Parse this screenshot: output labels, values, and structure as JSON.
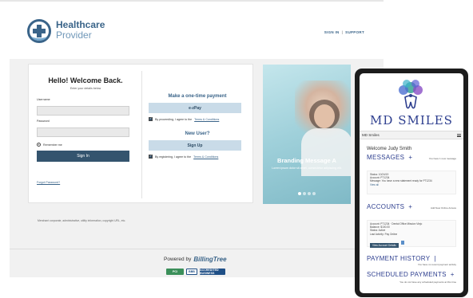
{
  "header": {
    "brand_line1": "Healthcare",
    "brand_line2": "Provider",
    "signin": "SIGN IN",
    "support": "SUPPORT"
  },
  "login": {
    "title": "Hello! Welcome Back.",
    "subtitle": "Enter your details below",
    "username_label": "Username",
    "username_value": "",
    "password_label": "Password",
    "password_value": "",
    "remember": "Remember me",
    "signin_button": "Sign In",
    "forgot": "Forgot Password?"
  },
  "payment": {
    "heading": "Make a one-time payment",
    "button": "e-zPay",
    "agree_prefix": "By proceeding, I agree to the",
    "agree_link": "Terms & Conditions"
  },
  "signup": {
    "heading": "New User?",
    "button": "Sign Up",
    "agree_prefix": "By registering, I agree to the",
    "agree_link": "Terms & Conditions"
  },
  "banner": {
    "heading": "Branding Message A",
    "body": "Lorem ipsum dolor sit amet, consectetur adipiscing elit.",
    "slides": 4,
    "active_slide": 1
  },
  "footer": {
    "legal": "Merchant corporate, administrative, utility information, copyright URL, etc.",
    "powered_by": "Powered by",
    "billingtree": "BillingTree",
    "seal_pci": "PCI",
    "seal_bbb": "BBB",
    "seal_accredited": "ACCREDITED BUSINESS"
  },
  "phone": {
    "brand": "MD SMILES",
    "nav_title": "MD Smiles",
    "welcome": "Welcome Judy Smith",
    "messages": {
      "title": "MESSAGES",
      "plus": "+",
      "action": "You have 1 new message",
      "status": "Status: 10/24/19",
      "account": "Account: PT1234",
      "message": "Message: You have a new statement ready for PT1234",
      "link": "View all"
    },
    "accounts": {
      "title": "ACCOUNTS",
      "plus": "+",
      "action": "Add New Online Access",
      "account": "Account: PT1234 · Dental Office Mission Viejo",
      "balance": "Balance: $100.00",
      "status": "Status: Active",
      "last_activity": "Last Activity: Pay Online",
      "button": "View Account Details"
    },
    "payment_history": {
      "title": "PAYMENT HISTORY",
      "plus": "|",
      "sub": "You have no recent payment activity"
    },
    "scheduled": {
      "title": "SCHEDULED PAYMENTS",
      "plus": "+",
      "sub": "You do not have any scheduled payments at this time"
    }
  },
  "colors": {
    "brand_blue": "#3a6489",
    "button_dark": "#34546e",
    "button_light": "#c9dbe8",
    "banner_teal": "#9fd0da",
    "phone_brand": "#2e3f8f"
  }
}
